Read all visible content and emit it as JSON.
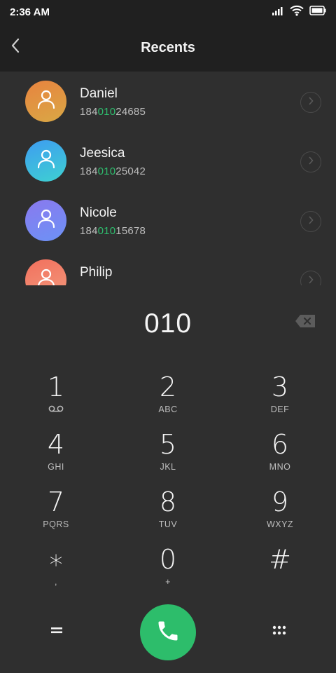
{
  "status_bar": {
    "time": "2:36 AM",
    "icons": [
      "signal-icon",
      "wifi-icon",
      "battery-icon"
    ]
  },
  "header": {
    "title": "Recents",
    "back_icon": "chevron-left-icon"
  },
  "recents": [
    {
      "name": "Daniel",
      "number_prefix": "184",
      "number_match": "010",
      "number_suffix": "24685",
      "avatar_gradient": [
        "#e8833f",
        "#d9a845"
      ]
    },
    {
      "name": "Jeesica",
      "number_prefix": "184",
      "number_match": "010",
      "number_suffix": "25042",
      "avatar_gradient": [
        "#3e9cf1",
        "#3ed1d1"
      ]
    },
    {
      "name": "Nicole",
      "number_prefix": "184",
      "number_match": "010",
      "number_suffix": "15678",
      "avatar_gradient": [
        "#8a79ef",
        "#6c92f5"
      ]
    },
    {
      "name": "Philip",
      "number_prefix": "",
      "number_match": "",
      "number_suffix": "",
      "avatar_gradient": [
        "#f2705d",
        "#f29a7d"
      ]
    }
  ],
  "dialer": {
    "entered_number": "010",
    "backspace_icon": "backspace-icon"
  },
  "keypad": [
    {
      "main": "1",
      "sub": ""
    },
    {
      "main": "2",
      "sub": "ABC"
    },
    {
      "main": "3",
      "sub": "DEF"
    },
    {
      "main": "4",
      "sub": "GHI"
    },
    {
      "main": "5",
      "sub": "JKL"
    },
    {
      "main": "6",
      "sub": "MNO"
    },
    {
      "main": "7",
      "sub": "PQRS"
    },
    {
      "main": "8",
      "sub": "TUV"
    },
    {
      "main": "9",
      "sub": "WXYZ"
    },
    {
      "main": "∗",
      "sub": ","
    },
    {
      "main": "0",
      "sub": "+"
    },
    {
      "main": "#",
      "sub": ""
    }
  ],
  "bottom_bar": {
    "left_icon": "menu-equals-icon",
    "call_icon": "phone-icon",
    "right_icon": "keypad-dots-icon"
  },
  "colors": {
    "background": "#2f2f2f",
    "header": "#202020",
    "accent_green": "#2dbd6b",
    "highlight_digits": "#2ebd6e"
  }
}
